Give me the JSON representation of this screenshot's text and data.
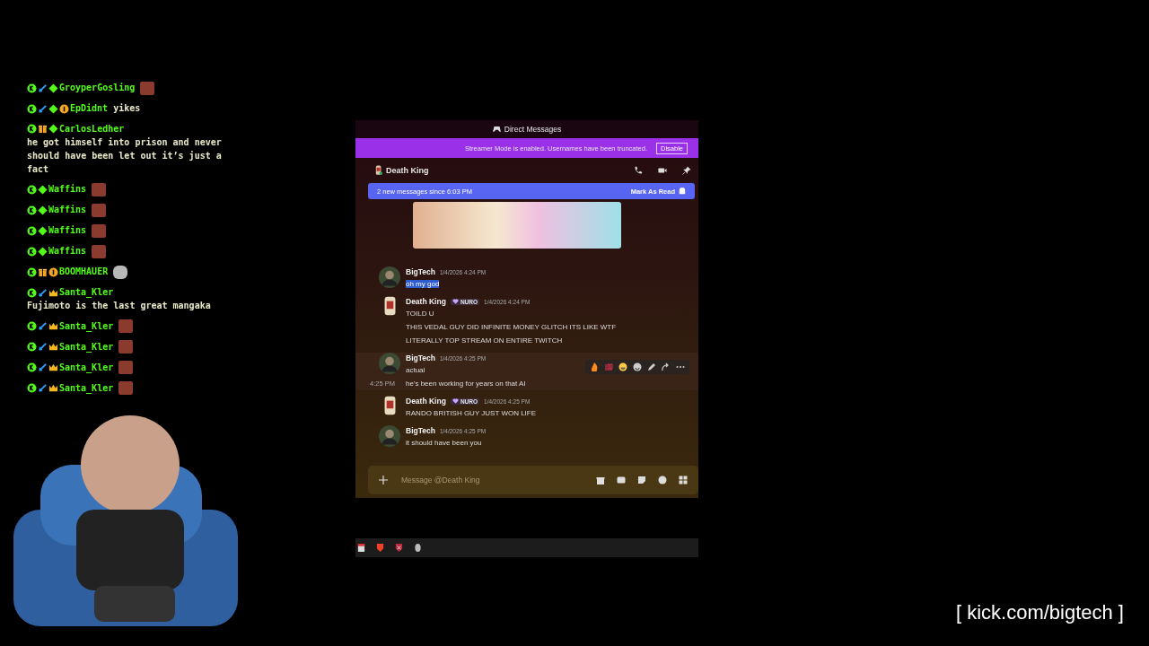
{
  "chat": [
    {
      "name": "GroyperGosling",
      "badges": [
        {
          "kind": "kick"
        },
        {
          "kind": "mod"
        },
        {
          "kind": "diamond"
        }
      ],
      "emote": {
        "kind": "face"
      }
    },
    {
      "name": "EpDidnt",
      "badges": [
        {
          "kind": "kick"
        },
        {
          "kind": "mod"
        },
        {
          "kind": "diamond"
        },
        {
          "kind": "sub"
        }
      ],
      "text": "yikes"
    },
    {
      "name": "CarlosLedher",
      "badges": [
        {
          "kind": "kick"
        },
        {
          "kind": "gift"
        },
        {
          "kind": "diamond"
        }
      ],
      "text": "he got himself into prison and never should have been let out it’s just a fact"
    },
    {
      "name": "Waffins",
      "badges": [
        {
          "kind": "kick"
        },
        {
          "kind": "diamond"
        }
      ],
      "emote": {
        "kind": "face"
      }
    },
    {
      "name": "Waffins",
      "badges": [
        {
          "kind": "kick"
        },
        {
          "kind": "diamond"
        }
      ],
      "emote": {
        "kind": "face"
      }
    },
    {
      "name": "Waffins",
      "badges": [
        {
          "kind": "kick"
        },
        {
          "kind": "diamond"
        }
      ],
      "emote": {
        "kind": "face"
      }
    },
    {
      "name": "Waffins",
      "badges": [
        {
          "kind": "kick"
        },
        {
          "kind": "diamond"
        }
      ],
      "emote": {
        "kind": "face"
      }
    },
    {
      "name": "BOOMHAUER",
      "badges": [
        {
          "kind": "kick"
        },
        {
          "kind": "gift"
        },
        {
          "kind": "sub"
        }
      ],
      "emote": {
        "kind": "cat"
      }
    },
    {
      "name": "Santa_Kler",
      "badges": [
        {
          "kind": "kick"
        },
        {
          "kind": "mod"
        },
        {
          "kind": "crown"
        }
      ],
      "text": "Fujimoto is the last great mangaka"
    },
    {
      "name": "Santa_Kler",
      "badges": [
        {
          "kind": "kick"
        },
        {
          "kind": "mod"
        },
        {
          "kind": "crown"
        }
      ],
      "emote": {
        "kind": "face"
      }
    },
    {
      "name": "Santa_Kler",
      "badges": [
        {
          "kind": "kick"
        },
        {
          "kind": "mod"
        },
        {
          "kind": "crown"
        }
      ],
      "emote": {
        "kind": "face"
      }
    },
    {
      "name": "Santa_Kler",
      "badges": [
        {
          "kind": "kick"
        },
        {
          "kind": "mod"
        },
        {
          "kind": "crown"
        }
      ],
      "emote": {
        "kind": "face"
      }
    },
    {
      "name": "Santa_Kler",
      "badges": [
        {
          "kind": "kick"
        },
        {
          "kind": "mod"
        },
        {
          "kind": "crown"
        }
      ],
      "emote": {
        "kind": "face"
      }
    }
  ],
  "discord": {
    "title": "Direct Messages",
    "banner": {
      "text": "Streamer Mode is enabled. Usernames have been truncated.",
      "button": "Disable"
    },
    "channel": "Death King",
    "new_bar": {
      "text": "2 new messages since 6:03 PM",
      "action": "Mark As Read"
    },
    "messages": [
      {
        "author": "BigTech",
        "kind": "own",
        "time": "1/4/2026 4:24 PM",
        "hovered": false,
        "lines": [
          {
            "text": "oh my god",
            "highlighted": true
          }
        ]
      },
      {
        "author": "Death King",
        "kind": "other",
        "tag": "NURO",
        "time": "1/4/2026 4:24 PM",
        "hovered": false,
        "lines": [
          {
            "text": "TOILD U",
            "highlighted": false
          },
          {
            "text": "THIS VEDAL GUY DID INFINITE MONEY GLITCH ITS LIKE WTF",
            "highlighted": false
          },
          {
            "text": "LITERALLY TOP STREAM ON ENTIRE TWITCH",
            "highlighted": false
          }
        ]
      },
      {
        "author": "BigTech",
        "kind": "own",
        "time": "1/4/2026 4:25 PM",
        "hovered": true,
        "lines": [
          {
            "text": "actual",
            "highlighted": false
          },
          {
            "text": "he's been working for years on that AI",
            "highlighted": false,
            "side_time": "4:25 PM"
          }
        ]
      },
      {
        "author": "Death King",
        "kind": "other",
        "tag": "NURO",
        "time": "1/4/2026 4:25 PM",
        "hovered": false,
        "lines": [
          {
            "text": "RANDO BRITISH GUY JUST WON LIFE",
            "highlighted": false
          }
        ]
      },
      {
        "author": "BigTech",
        "kind": "own",
        "time": "1/4/2026 4:25 PM",
        "hovered": false,
        "lines": [
          {
            "text": "it should have been you",
            "highlighted": false
          }
        ]
      }
    ],
    "input": {
      "placeholder": "Message @Death King"
    }
  },
  "overlay_text": "[ kick.com/bigtech ]"
}
